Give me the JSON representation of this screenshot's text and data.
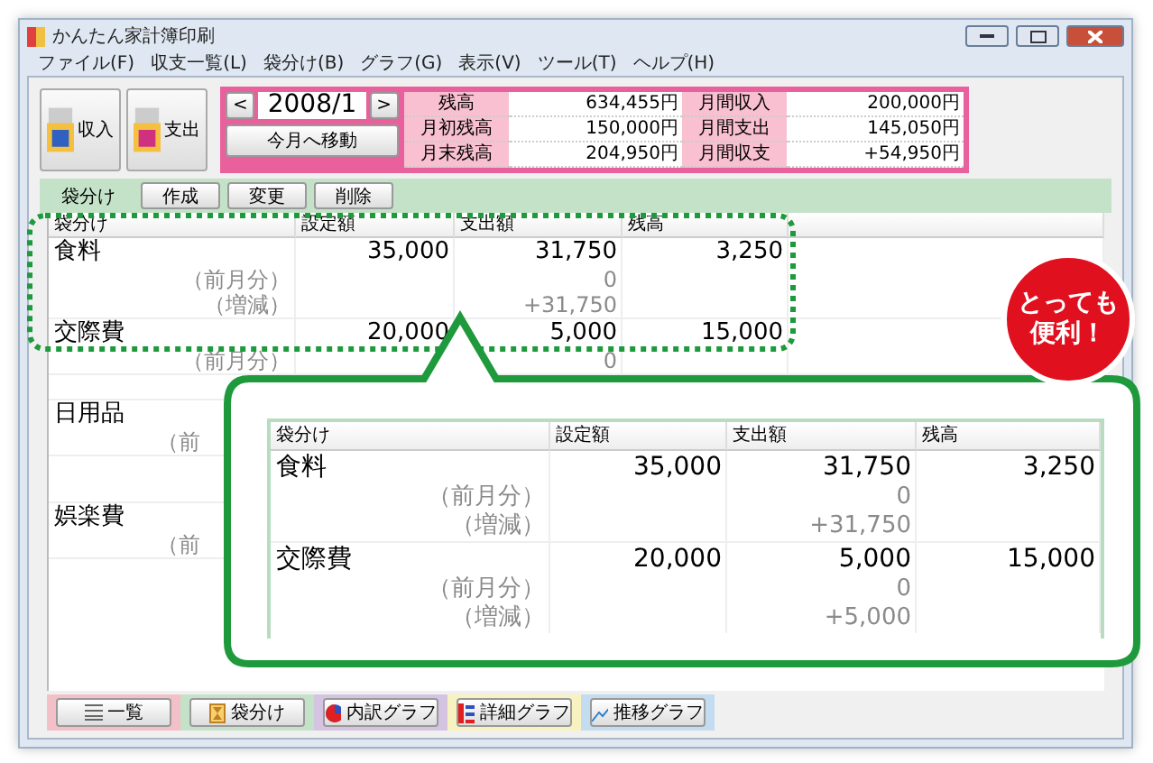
{
  "window": {
    "title": "かんたん家計簿印刷"
  },
  "menu": [
    "ファイル(F)",
    "収支一覧(L)",
    "袋分け(B)",
    "グラフ(G)",
    "表示(V)",
    "ツール(T)",
    "ヘルプ(H)"
  ],
  "toolbar": {
    "buttons": [
      {
        "label": "収入",
        "kind": "income"
      },
      {
        "label": "支出",
        "kind": "expense"
      }
    ],
    "prev": "<",
    "month": "2008/1",
    "next": ">",
    "today": "今月へ移動",
    "summary": [
      {
        "label": "残高",
        "value": "634,455円",
        "label2": "月間収入",
        "value2": "200,000円"
      },
      {
        "label": "月初残高",
        "value": "150,000円",
        "label2": "月間支出",
        "value2": "145,050円"
      },
      {
        "label": "月末残高",
        "value": "204,950円",
        "label2": "月間収支",
        "value2": "+54,950円"
      }
    ]
  },
  "envelope_bar": {
    "label": "袋分け",
    "buttons": [
      "作成",
      "変更",
      "削除"
    ]
  },
  "table": {
    "columns": [
      "袋分け",
      "設定額",
      "支出額",
      "残高"
    ],
    "rows": [
      {
        "name": "食料",
        "budget": "35,000",
        "spent": "31,750",
        "balance": "3,250",
        "sub": [
          {
            "label": "（前月分）",
            "value": "0"
          },
          {
            "label": "（増減）",
            "value": "+31,750"
          }
        ]
      },
      {
        "name": "交際費",
        "budget": "20,000",
        "spent": "5,000",
        "balance": "15,000",
        "sub": [
          {
            "label": "（前月分）",
            "value": "0"
          }
        ]
      },
      {
        "name": "日用品",
        "sub": [
          {
            "label": "（前"
          }
        ]
      },
      {
        "name": "娯楽費",
        "sub": [
          {
            "label": "（前"
          }
        ]
      }
    ]
  },
  "bottom_tabs": [
    {
      "label": "一覧",
      "kind": "list",
      "color": "#f4c0c8"
    },
    {
      "label": "袋分け",
      "kind": "envelope",
      "color": "#c4e2c8"
    },
    {
      "label": "内訳グラフ",
      "kind": "pie",
      "color": "#d4c4e2"
    },
    {
      "label": "詳細グラフ",
      "kind": "bars",
      "color": "#f8f2c0"
    },
    {
      "label": "推移グラフ",
      "kind": "line",
      "color": "#c4dcf0"
    }
  ],
  "callout": {
    "badge": [
      "とっても",
      "便利！"
    ],
    "table": {
      "columns": [
        "袋分け",
        "設定額",
        "支出額",
        "残高"
      ],
      "rows": [
        {
          "name": "食料",
          "budget": "35,000",
          "spent": "31,750",
          "balance": "3,250",
          "sub": [
            {
              "label": "（前月分）",
              "value": "0"
            },
            {
              "label": "（増減）",
              "value": "+31,750"
            }
          ]
        },
        {
          "name": "交際費",
          "budget": "20,000",
          "spent": "5,000",
          "balance": "15,000",
          "sub": [
            {
              "label": "（前月分）",
              "value": "0"
            },
            {
              "label": "（増減）",
              "value": "+5,000"
            }
          ]
        }
      ]
    }
  }
}
